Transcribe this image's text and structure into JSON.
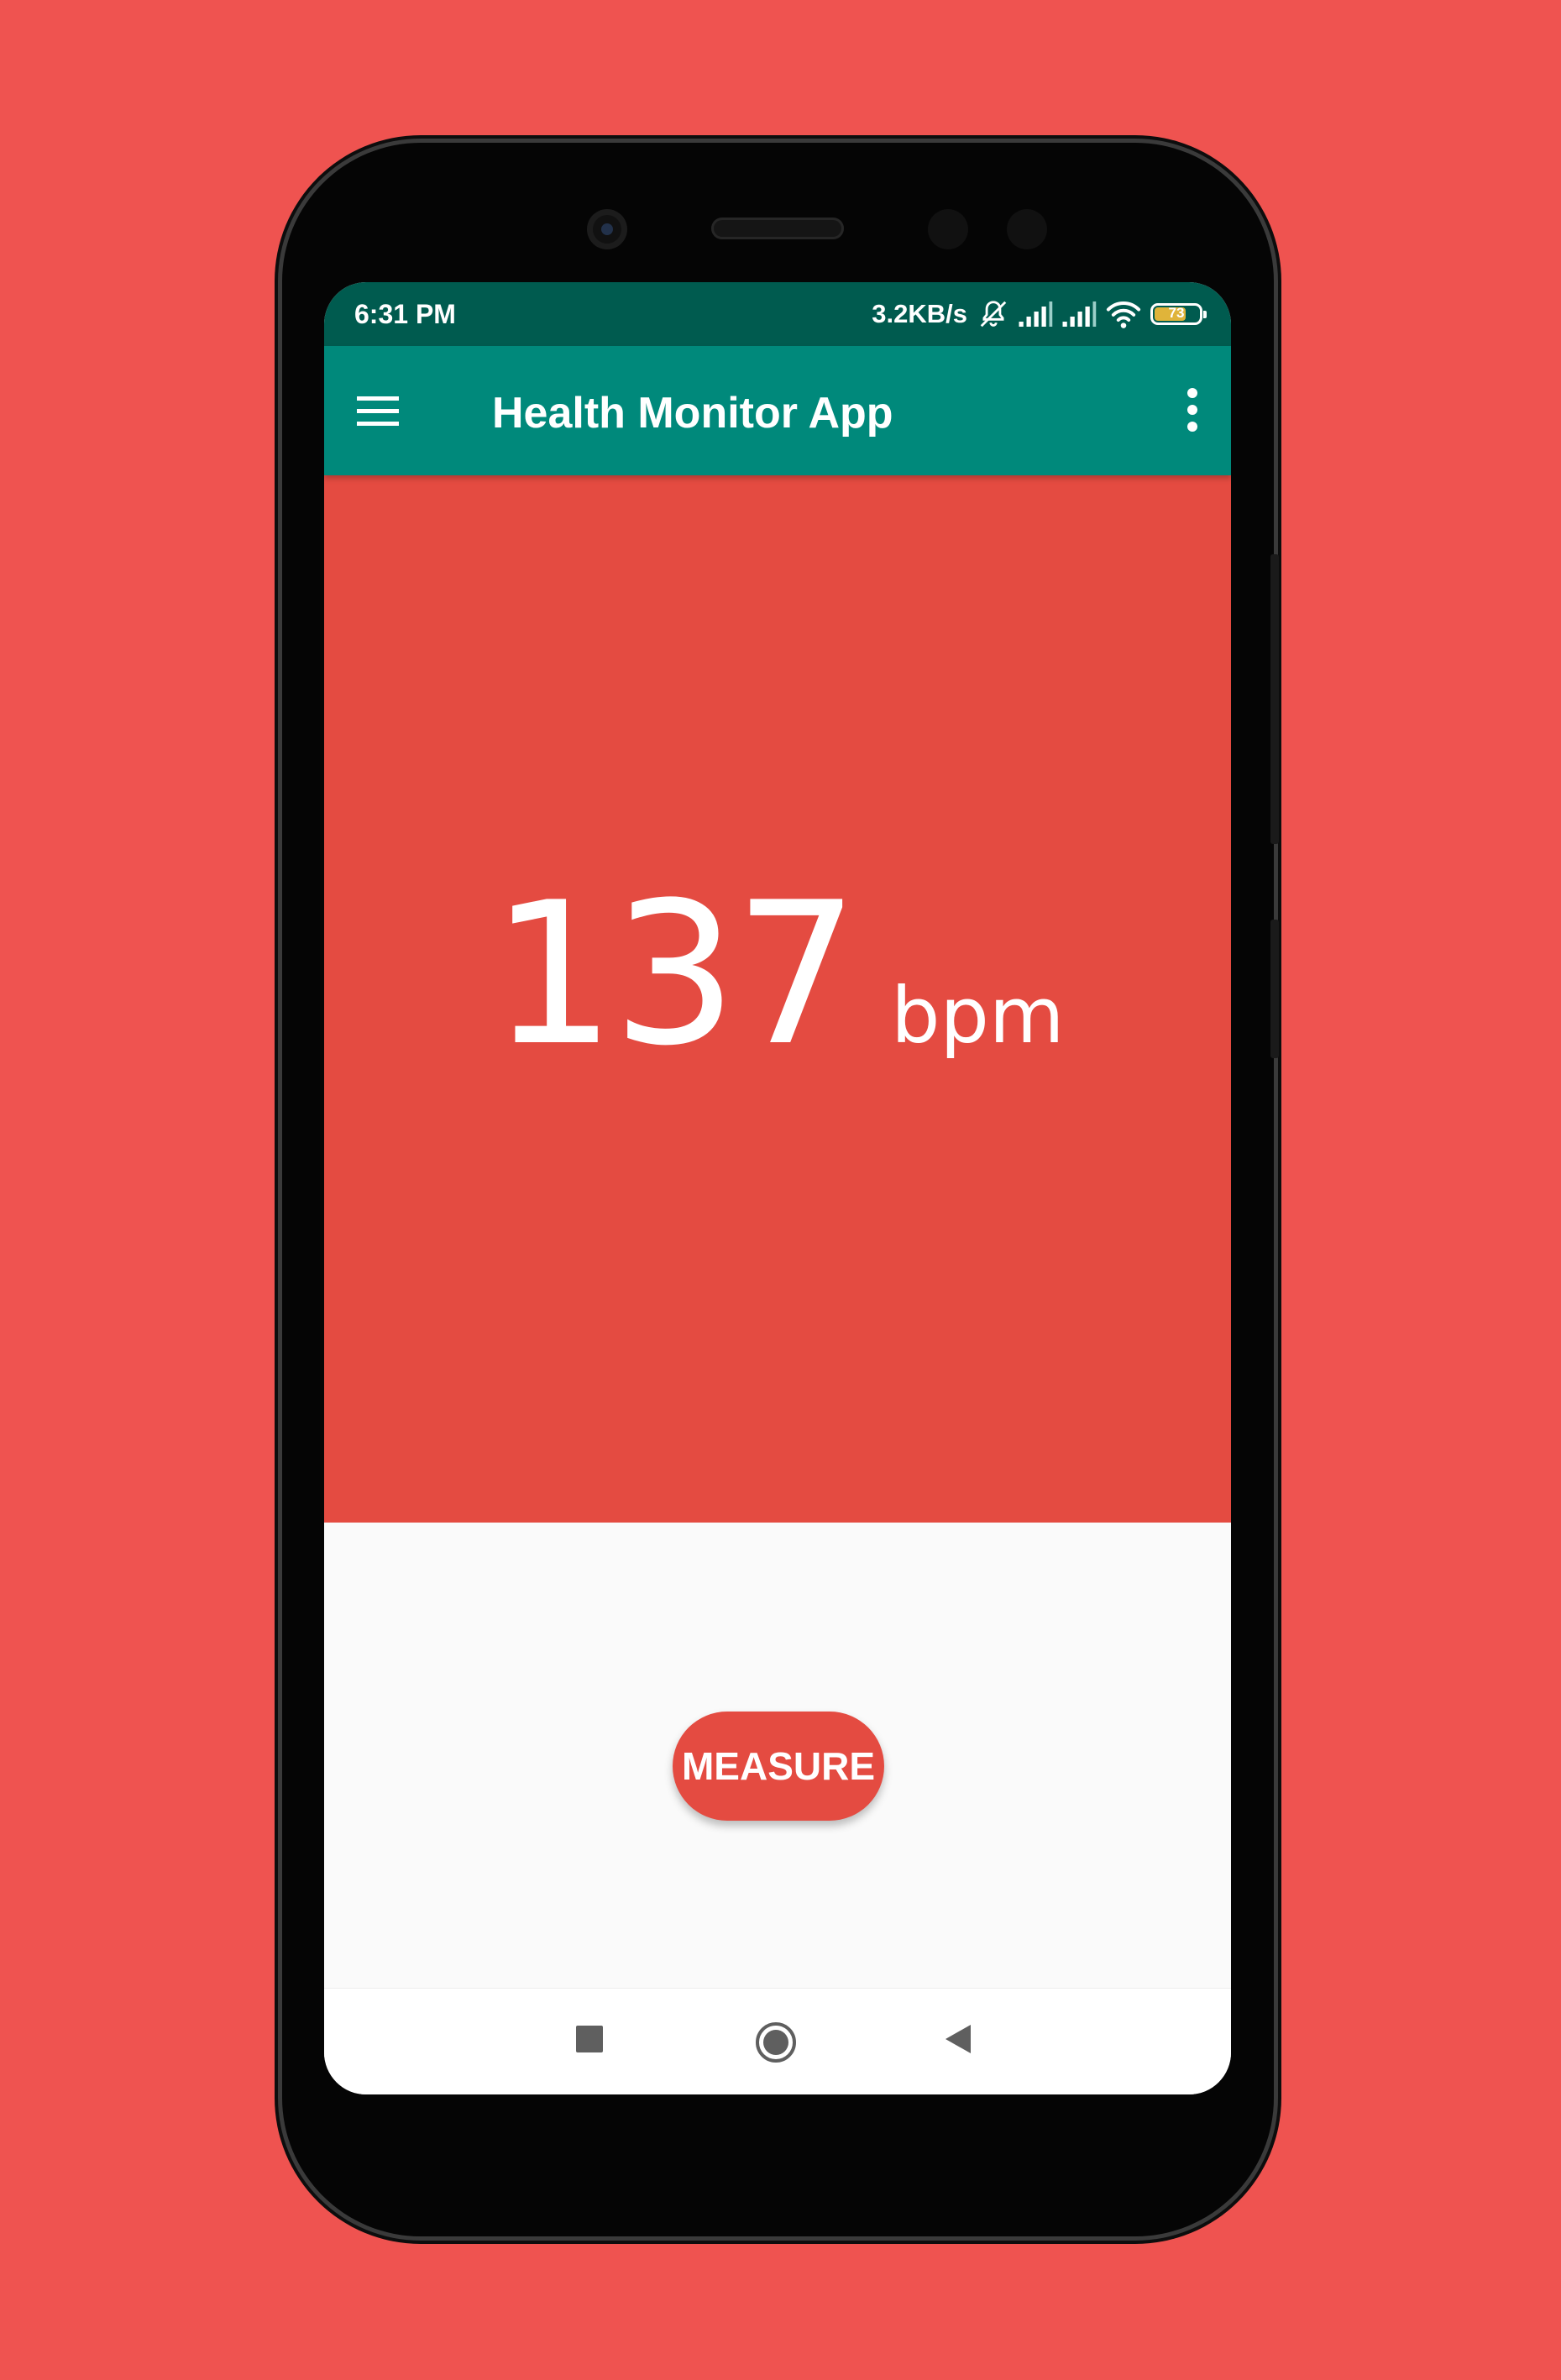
{
  "status_bar": {
    "time": "6:31 PM",
    "network_speed": "3.2KB/s",
    "battery_level": "73",
    "battery_fraction": 0.73,
    "icons": [
      "mute-bell-icon",
      "signal-icon",
      "signal-icon",
      "wifi-icon",
      "battery-icon"
    ]
  },
  "app_bar": {
    "title": "Health Monitor App",
    "menu_icon": "hamburger-menu-icon",
    "overflow_icon": "more-vert-icon"
  },
  "reading": {
    "value": "137",
    "unit": "bpm"
  },
  "actions": {
    "measure_label": "MEASURE"
  },
  "nav_bar": {
    "icons": [
      "recent-apps-icon",
      "home-icon",
      "back-icon"
    ]
  },
  "colors": {
    "background": "#EF5350",
    "status_bar": "#005B4F",
    "app_bar": "#00897B",
    "hero": "#E44B41",
    "button": "#E44B41",
    "battery_fill": "#E0B43A"
  }
}
